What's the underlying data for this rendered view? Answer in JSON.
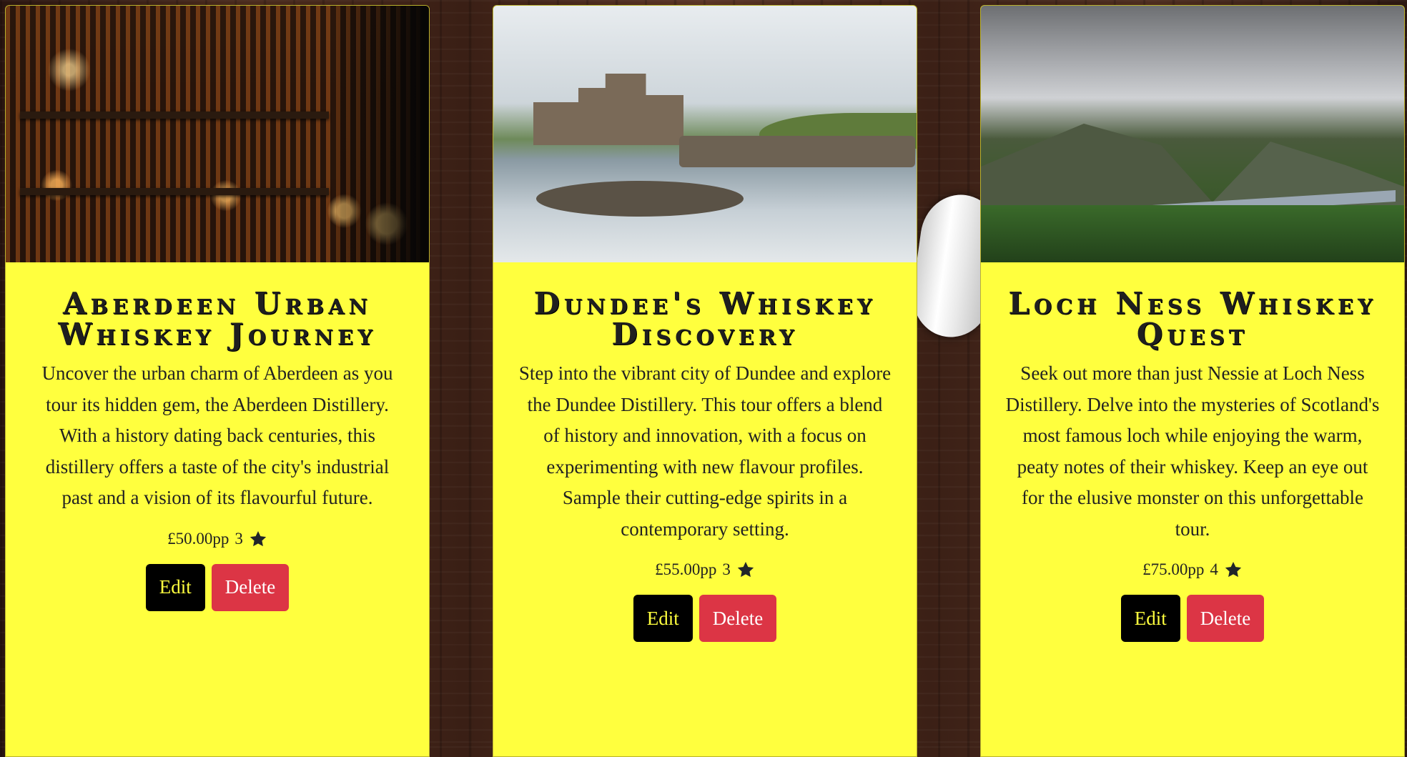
{
  "tours": [
    {
      "image_alt": "Dimly lit whiskey bar with shelves of bottles and candles",
      "title": "Aberdeen Urban Whiskey Journey",
      "description": "Uncover the urban charm of Aberdeen as you tour its hidden gem, the Aberdeen Distillery. With a history dating back centuries, this distillery offers a taste of the city's industrial past and a vision of its flavourful future.",
      "price": "£50.00pp",
      "rating": "3",
      "edit_label": "Edit",
      "delete_label": "Delete"
    },
    {
      "image_alt": "Castle on a rocky island with a stone bridge reflected in a loch",
      "title": "Dundee's Whiskey Discovery",
      "description": "Step into the vibrant city of Dundee and explore the Dundee Distillery. This tour offers a blend of history and innovation, with a focus on experimenting with new flavour profiles. Sample their cutting-edge spirits in a contemporary setting.",
      "price": "£55.00pp",
      "rating": "3",
      "edit_label": "Edit",
      "delete_label": "Delete"
    },
    {
      "image_alt": "Cloudy sky over mountains and a long loch with green forest",
      "title": "Loch Ness Whiskey Quest",
      "description": "Seek out more than just Nessie at Loch Ness Distillery. Delve into the mysteries of Scotland's most famous loch while enjoying the warm, peaty notes of their whiskey. Keep an eye out for the elusive monster on this unforgettable tour.",
      "price": "£75.00pp",
      "rating": "4",
      "edit_label": "Edit",
      "delete_label": "Delete"
    }
  ],
  "icons": {
    "rating": "star-icon"
  },
  "colors": {
    "card_background": "#ffff3e",
    "edit_button": "#000000",
    "delete_button": "#dc3545"
  }
}
